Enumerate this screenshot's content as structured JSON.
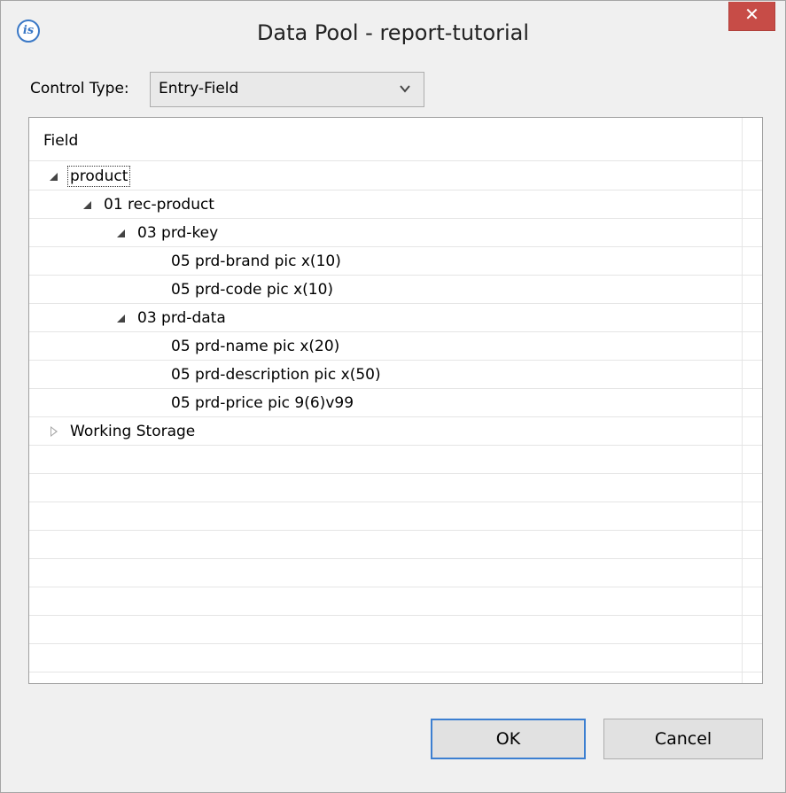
{
  "window": {
    "title": "Data Pool - report-tutorial",
    "logo_text": "is",
    "close_label": "✕",
    "accent": "#c74c47"
  },
  "control_type": {
    "label": "Control Type:",
    "value": "Entry-Field"
  },
  "table": {
    "column_header": "Field",
    "rows": [
      {
        "label": "product",
        "level": 0,
        "state": "expanded",
        "focused": true
      },
      {
        "label": "01 rec-product",
        "level": 1,
        "state": "expanded"
      },
      {
        "label": "03 prd-key",
        "level": 2,
        "state": "expanded"
      },
      {
        "label": "05 prd-brand pic x(10)",
        "level": 3,
        "state": "leaf"
      },
      {
        "label": "05 prd-code pic x(10)",
        "level": 3,
        "state": "leaf"
      },
      {
        "label": "03 prd-data",
        "level": 2,
        "state": "expanded"
      },
      {
        "label": "05 prd-name pic x(20)",
        "level": 3,
        "state": "leaf"
      },
      {
        "label": "05 prd-description pic x(50)",
        "level": 3,
        "state": "leaf"
      },
      {
        "label": "05 prd-price pic 9(6)v99",
        "level": 3,
        "state": "leaf"
      },
      {
        "label": "Working Storage",
        "level": 0,
        "state": "collapsed"
      }
    ],
    "empty_rows": 9
  },
  "buttons": {
    "ok": "OK",
    "cancel": "Cancel"
  }
}
